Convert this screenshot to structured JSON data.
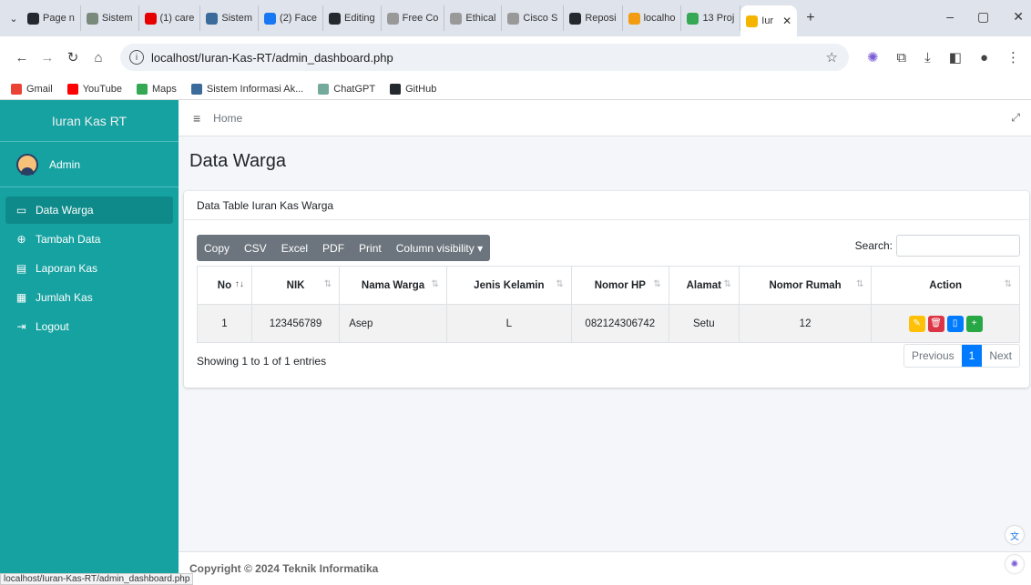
{
  "browser": {
    "tabs": [
      {
        "label": "Page n",
        "color": "#24292f"
      },
      {
        "label": "Sistem",
        "color": "#7a8a7a"
      },
      {
        "label": "(1) care",
        "color": "#e60000"
      },
      {
        "label": "Sistem",
        "color": "#3a6b9a"
      },
      {
        "label": "(2) Face",
        "color": "#1877f2"
      },
      {
        "label": "Editing",
        "color": "#24292f"
      },
      {
        "label": "Free Co",
        "color": "#999999"
      },
      {
        "label": "Ethical",
        "color": "#999999"
      },
      {
        "label": "Cisco S",
        "color": "#999999"
      },
      {
        "label": "Reposi",
        "color": "#24292f"
      },
      {
        "label": "localho",
        "color": "#f39c12"
      },
      {
        "label": "13 Proj",
        "color": "#34a853"
      }
    ],
    "active_tab": {
      "label": "Iur",
      "color": "#f4b400"
    },
    "url": "localhost/Iuran-Kas-RT/admin_dashboard.php",
    "bookmarks": [
      {
        "label": "Gmail",
        "color": "#ea4335"
      },
      {
        "label": "YouTube",
        "color": "#ff0000"
      },
      {
        "label": "Maps",
        "color": "#34a853"
      },
      {
        "label": "Sistem Informasi Ak...",
        "color": "#3a6b9a"
      },
      {
        "label": "ChatGPT",
        "color": "#74aa9c"
      },
      {
        "label": "GitHub",
        "color": "#24292f"
      }
    ],
    "status_url": "localhost/Iuran-Kas-RT/admin_dashboard.php"
  },
  "sidebar": {
    "brand": "Iuran Kas RT",
    "user": "Admin",
    "items": [
      {
        "label": "Data Warga",
        "icon": "monitor-icon",
        "glyph": "▭",
        "active": true
      },
      {
        "label": "Tambah Data",
        "icon": "plus-circle-icon",
        "glyph": "⊕",
        "active": false
      },
      {
        "label": "Laporan Kas",
        "icon": "id-card-icon",
        "glyph": "▤",
        "active": false
      },
      {
        "label": "Jumlah Kas",
        "icon": "cash-register-icon",
        "glyph": "▦",
        "active": false
      },
      {
        "label": "Logout",
        "icon": "sign-out-icon",
        "glyph": "⇥",
        "active": false
      }
    ]
  },
  "topnav": {
    "home": "Home"
  },
  "page": {
    "title": "Data Warga"
  },
  "card": {
    "title": "Data Table Iuran Kas Warga",
    "buttons": [
      "Copy",
      "CSV",
      "Excel",
      "PDF",
      "Print",
      "Column visibility ▾"
    ],
    "search_label": "Search:",
    "search_value": "",
    "columns": [
      "No",
      "NIK",
      "Nama Warga",
      "Jenis Kelamin",
      "Nomor HP",
      "Alamat",
      "Nomor Rumah",
      "Action"
    ],
    "rows": [
      {
        "no": "1",
        "nik": "123456789",
        "nama": "Asep",
        "jk": "L",
        "hp": "082124306742",
        "alamat": "Setu",
        "rumah": "12"
      }
    ],
    "info": "Showing 1 to 1 of 1 entries",
    "pager": {
      "prev": "Previous",
      "current": "1",
      "next": "Next"
    }
  },
  "actions": [
    {
      "icon": "edit-icon",
      "glyph": "✎",
      "color": "#ffc107"
    },
    {
      "icon": "trash-icon",
      "glyph": "🗑",
      "color": "#dc3545"
    },
    {
      "icon": "file-icon",
      "glyph": "▯",
      "color": "#007bff"
    },
    {
      "icon": "plus-circle-icon",
      "glyph": "+",
      "color": "#28a745"
    }
  ],
  "footer": {
    "text": "Copyright © 2024 Teknik Informatika"
  },
  "colors": {
    "sidebar": "#17a2a2",
    "primary": "#007bff"
  }
}
